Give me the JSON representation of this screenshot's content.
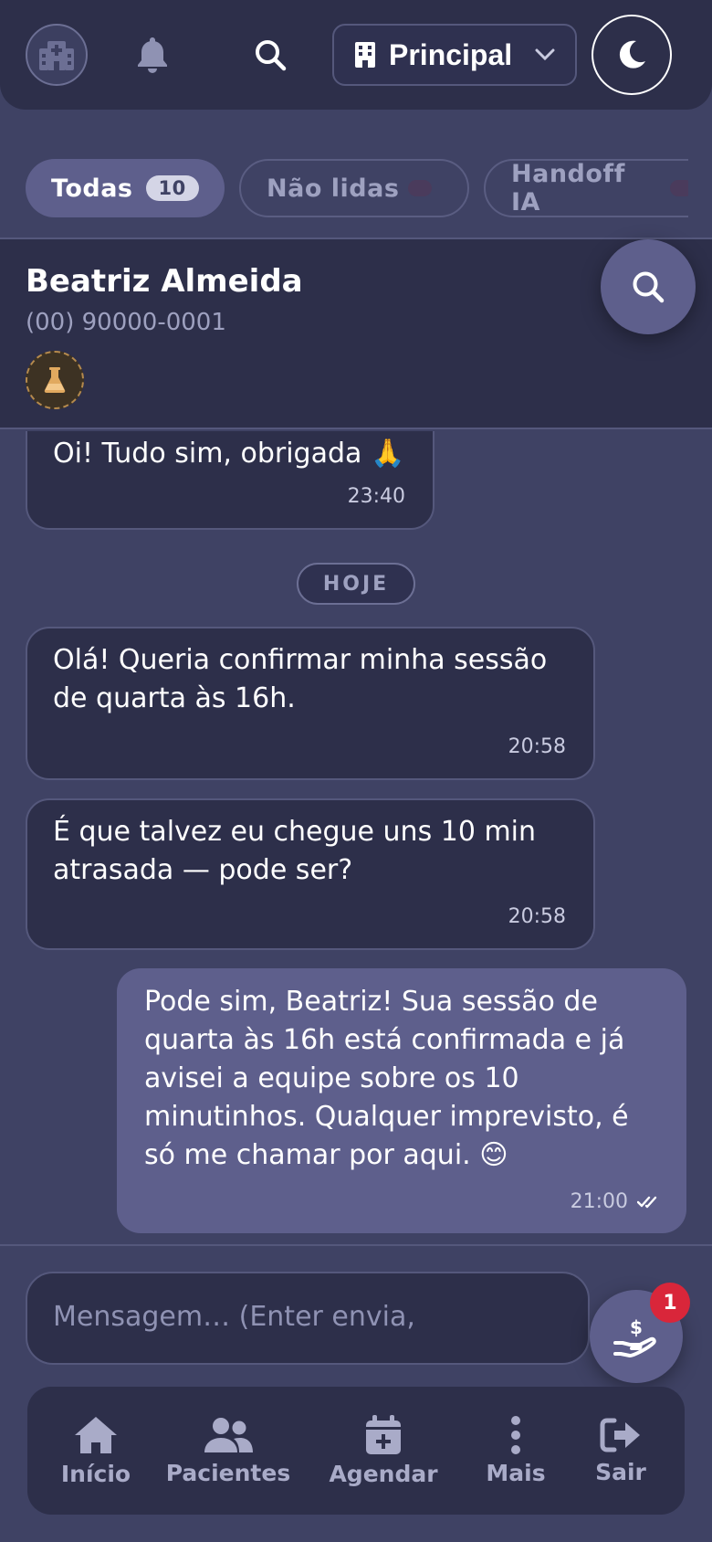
{
  "header": {
    "logo_icon": "hospital-icon",
    "notifications_icon": "bell-icon",
    "search_icon": "search-icon",
    "unit_select": {
      "icon": "building-icon",
      "value": "Principal"
    },
    "theme_toggle_icon": "moon-icon"
  },
  "filters": [
    {
      "label": "Todas",
      "count": "10",
      "active": true
    },
    {
      "label": "Não lidas",
      "active": false
    },
    {
      "label": "Handoff IA",
      "active": false
    }
  ],
  "contact": {
    "name": "Beatriz Almeida",
    "phone": "(00) 90000-0001",
    "tag_icon": "flask-icon",
    "search_icon": "search-icon"
  },
  "messages": [
    {
      "direction": "in",
      "text": "Oi! Tudo sim, obrigada 🙏",
      "time": "23:40"
    },
    {
      "type": "day",
      "label": "HOJE"
    },
    {
      "direction": "in",
      "text": "Olá! Queria confirmar minha sessão de quarta às 16h.",
      "time": "20:58"
    },
    {
      "direction": "in",
      "text": "É que talvez eu chegue uns 10 min atrasada — pode ser?",
      "time": "20:58"
    },
    {
      "direction": "out",
      "text": "Pode sim, Beatriz! Sua sessão de quarta às 16h está confirmada e já avisei a equipe sobre os 10 minutinhos. Qualquer imprevisto, é só me chamar por aqui. 😊",
      "time": "21:00",
      "status_icon": "double-check-icon"
    }
  ],
  "composer": {
    "placeholder": "Mensagem… (Enter envia, Shift+Enter quebra linha)"
  },
  "payment_fab": {
    "icon": "hand-dollar-icon",
    "badge": "1"
  },
  "bottom_nav": [
    {
      "label": "Início",
      "icon": "home-icon"
    },
    {
      "label": "Pacientes",
      "icon": "users-icon"
    },
    {
      "label": "Agendar",
      "icon": "calendar-plus-icon"
    },
    {
      "label": "Mais",
      "icon": "dots-vertical-icon"
    },
    {
      "label": "Sair",
      "icon": "logout-icon"
    }
  ],
  "colors": {
    "background": "#3f4264",
    "surface": "#2d2f4a",
    "accent": "#5e5f8c",
    "badge": "#d9263a"
  }
}
